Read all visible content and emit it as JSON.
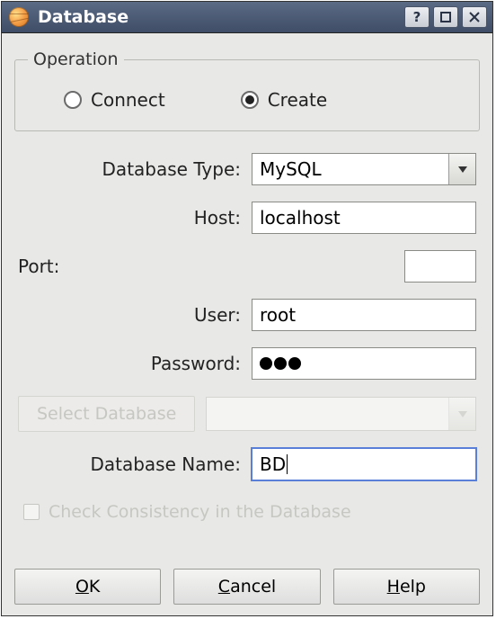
{
  "window": {
    "title": "Database"
  },
  "operation": {
    "legend": "Operation",
    "connect_label": "Connect",
    "create_label": "Create",
    "selected": "create"
  },
  "form": {
    "db_type_label": "Database Type:",
    "db_type_value": "MySQL",
    "host_label": "Host:",
    "host_value": "localhost",
    "port_label": "Port:",
    "port_value": "",
    "user_label": "User:",
    "user_value": "root",
    "password_label": "Password:",
    "password_value": "•••",
    "select_db_button": "Select Database",
    "db_name_label": "Database Name:",
    "db_name_value": "BD",
    "check_consistency_label": "Check Consistency in the Database"
  },
  "buttons": {
    "ok": "OK",
    "ok_mnemonic": "O",
    "ok_rest": "K",
    "cancel_mnemonic": "C",
    "cancel_rest": "ancel",
    "help_mnemonic": "H",
    "help_rest": "elp"
  }
}
